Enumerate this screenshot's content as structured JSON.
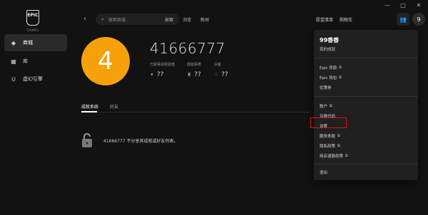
{
  "window_controls": [
    "—",
    "□",
    "✕"
  ],
  "sidebar": {
    "logo_text": "EPIC",
    "logo_subtext": "GAMES",
    "items": [
      {
        "label": "商城",
        "icon": "tag-icon",
        "glyph": "◆",
        "active": true
      },
      {
        "label": "库",
        "icon": "grid-icon",
        "glyph": "▦",
        "active": false
      },
      {
        "label": "虚幻引擎",
        "icon": "unreal-icon",
        "glyph": "U",
        "active": false
      }
    ]
  },
  "topbar": {
    "back_glyph": "‹",
    "search_placeholder": "搜索商城",
    "nav": [
      "探索",
      "浏览",
      "新闻"
    ],
    "wishlist": "愿望清单",
    "cart": "购物车",
    "avatar_initial": "9"
  },
  "profile": {
    "avatar_initial": "4",
    "username": "41666777",
    "stats": [
      {
        "label": "已获得总经验值",
        "value": "??",
        "icon": "sparkle-icon",
        "glyph": "✦"
      },
      {
        "label": "成就系统",
        "value": "??",
        "icon": "trophy-icon",
        "glyph": "♜"
      },
      {
        "label": "白金",
        "value": "??",
        "icon": "platinum-icon",
        "glyph": "♢"
      }
    ]
  },
  "tabs": [
    {
      "label": "成就系统",
      "active": true
    },
    {
      "label": "好友",
      "active": false
    }
  ],
  "empty_state": {
    "message": "41666777 不分享其成就或好友列表。"
  },
  "account_menu": {
    "display_name": "99香香",
    "my_achievements": "我的成就",
    "group1": [
      {
        "label": "Epic 奖励",
        "external": true
      },
      {
        "label": "Epic 钱包",
        "external": true
      },
      {
        "label": "优惠券",
        "external": false
      }
    ],
    "group2": [
      {
        "label": "账户",
        "external": true
      },
      {
        "label": "兑换代码",
        "external": false
      },
      {
        "label": "设置",
        "external": false
      },
      {
        "label": "服务条款",
        "external": true
      },
      {
        "label": "隐私政策",
        "external": true
      },
      {
        "label": "商店退款政策",
        "external": true
      }
    ],
    "sign_out": "退出",
    "external_glyph": "⧉"
  },
  "colors": {
    "avatar_orange": "#f7a10a",
    "highlight_red": "#dd1111",
    "background": "#121212",
    "menu_bg": "#202020"
  }
}
